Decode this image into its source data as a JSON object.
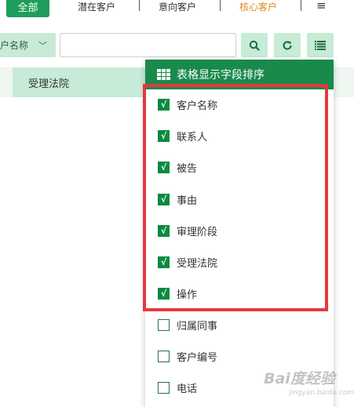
{
  "tabs": {
    "all": "全部",
    "potential": "潜在客户",
    "intent": "意向客户",
    "core": "核心客户",
    "menu_icon": "hamburger-icon",
    "core_color": "#e08a1e"
  },
  "filter": {
    "field_value": "户名称",
    "input_value": "",
    "buttons": [
      "search-icon",
      "refresh-icon",
      "columns-icon"
    ]
  },
  "table": {
    "header_cell": "受理法院"
  },
  "panel": {
    "title": "表格显示字段排序",
    "options": [
      {
        "label": "客户名称",
        "checked": true
      },
      {
        "label": "联系人",
        "checked": true
      },
      {
        "label": "被告",
        "checked": true
      },
      {
        "label": "事由",
        "checked": true
      },
      {
        "label": "审理阶段",
        "checked": true
      },
      {
        "label": "受理法院",
        "checked": true
      },
      {
        "label": "操作",
        "checked": true
      },
      {
        "label": "归属同事",
        "checked": false
      },
      {
        "label": "客户编号",
        "checked": false
      },
      {
        "label": "电话",
        "checked": false
      }
    ],
    "check_mark": "√"
  },
  "watermark": {
    "text": "Bai度经验",
    "sub": "jingyan.baidu.com"
  },
  "colors": {
    "accent": "#1e9e5a",
    "panel_header": "#1a8a4c",
    "light_green": "#c7ebd6",
    "highlight": "#e8383d"
  }
}
